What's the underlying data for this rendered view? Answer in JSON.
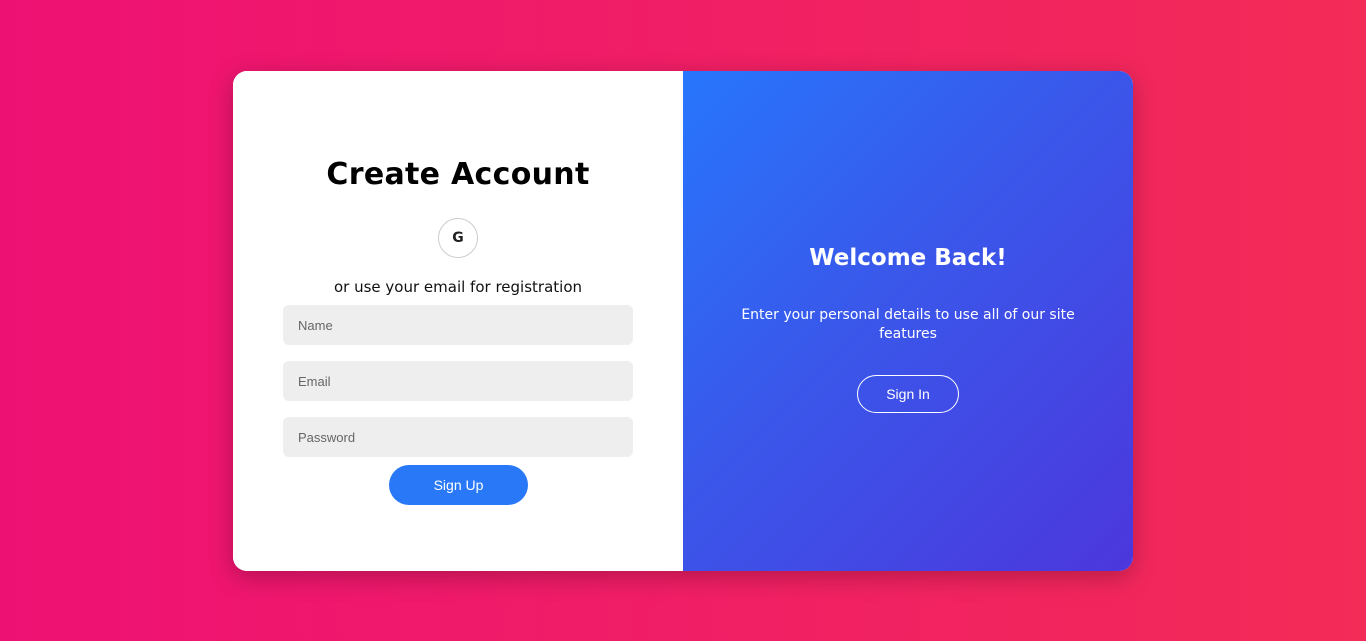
{
  "signup": {
    "title": "Create Account",
    "social_icon": "google-icon",
    "social_glyph": "G",
    "subtitle": "or use your email for registration",
    "name_placeholder": "Name",
    "email_placeholder": "Email",
    "password_placeholder": "Password",
    "button_label": "Sign Up"
  },
  "welcome": {
    "title": "Welcome Back!",
    "text": "Enter your personal details to use all of our site features",
    "button_label": "Sign In"
  },
  "colors": {
    "background_gradient": [
      "#ee1174",
      "#f32b57"
    ],
    "panel_gradient": [
      "#2776fc",
      "#4c37dc"
    ],
    "primary_button": "#2878f8",
    "input_background": "#eeeeee"
  }
}
